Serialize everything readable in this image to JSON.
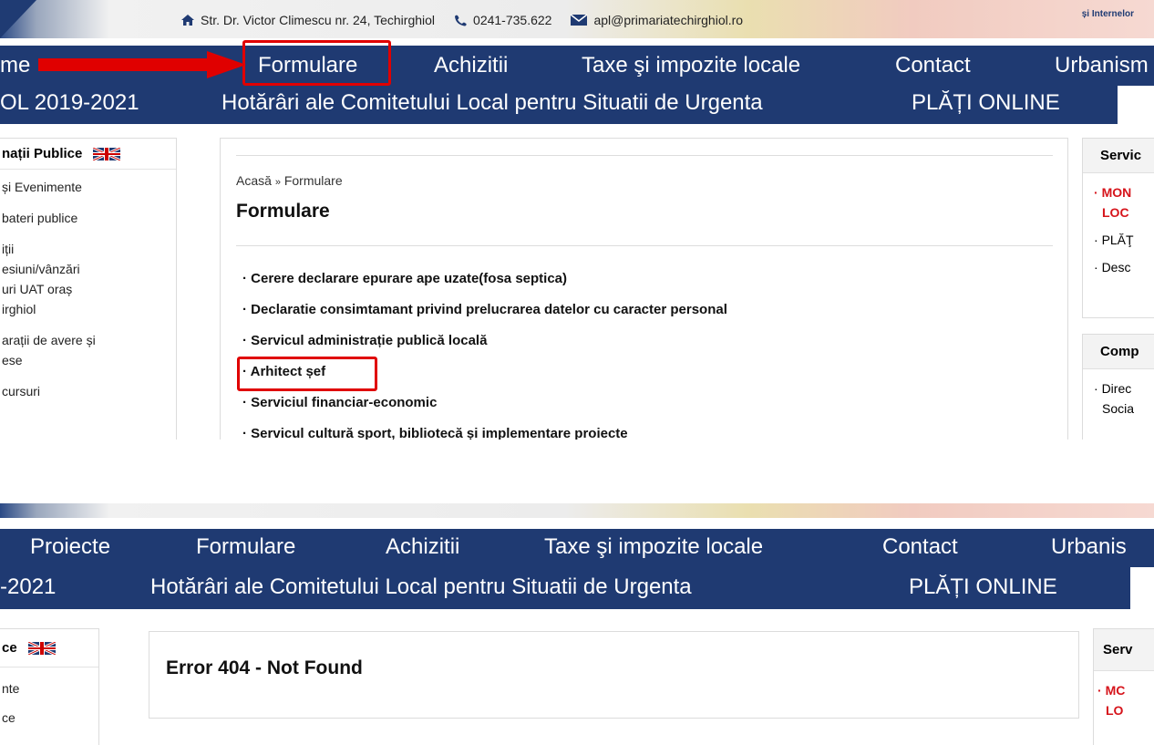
{
  "header": {
    "address": "Str. Dr. Victor Climescu nr. 24, Techirghiol",
    "phone": "0241-735.622",
    "email": "apl@primariatechirghiol.ro",
    "eu_text": "și Internelor"
  },
  "nav": {
    "row1": [
      "me",
      "Formulare",
      "Achizitii",
      "Taxe şi impozite locale",
      "Contact",
      "Urbanism"
    ],
    "row2": [
      "OL 2019-2021",
      "Hotărâri ale Comitetului Local pentru Situatii de Urgenta",
      "PLĂȚI ONLINE"
    ]
  },
  "left_sidebar": {
    "title": "nații Publice",
    "items": [
      "și Evenimente",
      "bateri publice",
      "iții",
      "esiuni/vânzări",
      "uri UAT oraș",
      "irghiol",
      "arații de avere și",
      "ese",
      "cursuri"
    ]
  },
  "main": {
    "breadcrumb_home": "Acasă",
    "breadcrumb_sep": "»",
    "breadcrumb_current": "Formulare",
    "title": "Formulare",
    "items": [
      "Cerere declarare epurare ape uzate(fosa septica)",
      "Declaratie consimtamant privind prelucrarea datelor cu caracter personal",
      "Servicul administrație publică locală",
      "Arhitect șef",
      "Serviciul financiar-economic",
      "Servicul cultură sport, bibliotecă și implementare proiecte"
    ],
    "bullet": "·"
  },
  "right_sidebar": {
    "title1": "Servic",
    "items1": [
      "MON",
      "LOC",
      "PLĂŢ",
      "Desc"
    ],
    "title2": "Comp",
    "items2": [
      "Direc",
      "Socia"
    ]
  },
  "shot2": {
    "nav_row1": [
      "Proiecte",
      "Formulare",
      "Achizitii",
      "Taxe şi impozite locale",
      "Contact",
      "Urbanis"
    ],
    "nav_row2": [
      "-2021",
      "Hotărâri ale Comitetului Local pentru Situatii de Urgenta",
      "PLĂȚI ONLINE"
    ],
    "left_title": "ce",
    "left_items": [
      "nte",
      "ce"
    ],
    "error_title": "Error 404 - Not Found",
    "right_title": "Serv",
    "right_items": [
      "MC",
      "LO"
    ]
  },
  "colors": {
    "nav_bg": "#1f3a72",
    "highlight": "#e00000",
    "link_red": "#d6141b"
  },
  "icons": [
    "home-icon",
    "phone-icon",
    "email-icon",
    "uk-flag-icon",
    "right-arrow-icon"
  ]
}
